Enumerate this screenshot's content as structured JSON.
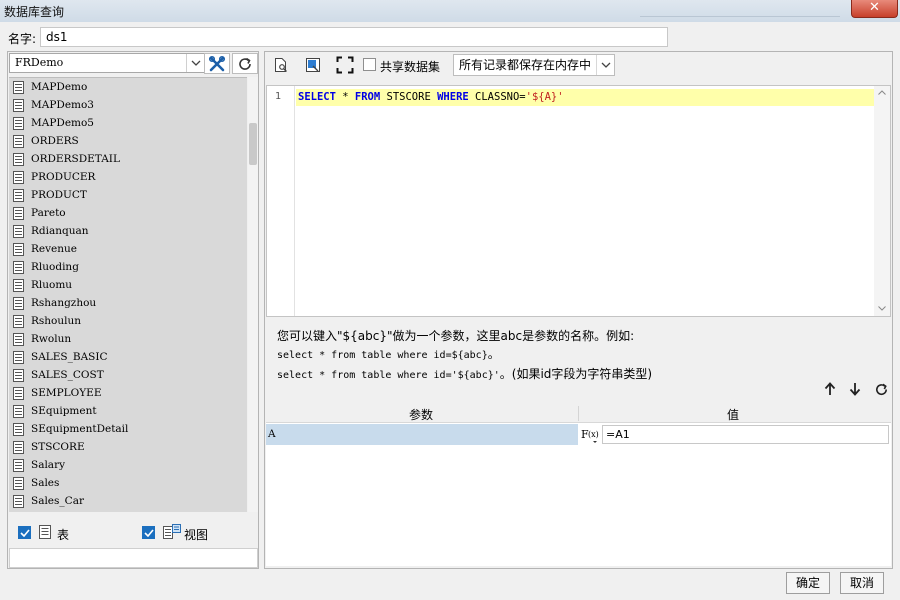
{
  "window": {
    "title": "数据库查询",
    "close_label": "✕"
  },
  "name_row": {
    "label": "名字:",
    "value": "ds1"
  },
  "datasource": {
    "selected": "FRDemo"
  },
  "tables": [
    "MAPDemo",
    "MAPDemo3",
    "MAPDemo5",
    "ORDERS",
    "ORDERSDETAIL",
    "PRODUCER",
    "PRODUCT",
    "Pareto",
    "Rdianquan",
    "Revenue",
    "Rluoding",
    "Rluomu",
    "Rshangzhou",
    "Rshoulun",
    "Rwolun",
    "SALES_BASIC",
    "SALES_COST",
    "SEMPLOYEE",
    "SEquipment",
    "SEquipmentDetail",
    "STSCORE",
    "Salary",
    "Sales",
    "Sales_Car"
  ],
  "filters": {
    "table_label": "表",
    "view_label": "视图",
    "table_checked": true,
    "view_checked": true
  },
  "toolbar": {
    "share_label": "共享数据集",
    "share_checked": false,
    "cache_mode": "所有记录都保存在内存中"
  },
  "editor": {
    "line_number": "1",
    "sql_tokens": [
      {
        "t": "SELECT",
        "c": "kw"
      },
      {
        "t": " * ",
        "c": ""
      },
      {
        "t": "FROM",
        "c": "kw"
      },
      {
        "t": " STSCORE ",
        "c": ""
      },
      {
        "t": "WHERE",
        "c": "kw"
      },
      {
        "t": " CLASSNO=",
        "c": ""
      },
      {
        "t": "'${A}'",
        "c": "str"
      }
    ]
  },
  "hint": {
    "line1": "您可以键入\"${abc}\"做为一个参数，这里abc是参数的名称。例如:",
    "line2_code": "select * from table where id=${abc}",
    "line2_tail": "。",
    "line3_code": "select * from table where id='${abc}'",
    "line3_tail": "。(如果id字段为字符串类型)"
  },
  "params": {
    "col_name": "参数",
    "col_value": "值",
    "rows": [
      {
        "name": "A",
        "value": "=A1"
      }
    ]
  },
  "buttons": {
    "ok": "确定",
    "cancel": "取消"
  }
}
